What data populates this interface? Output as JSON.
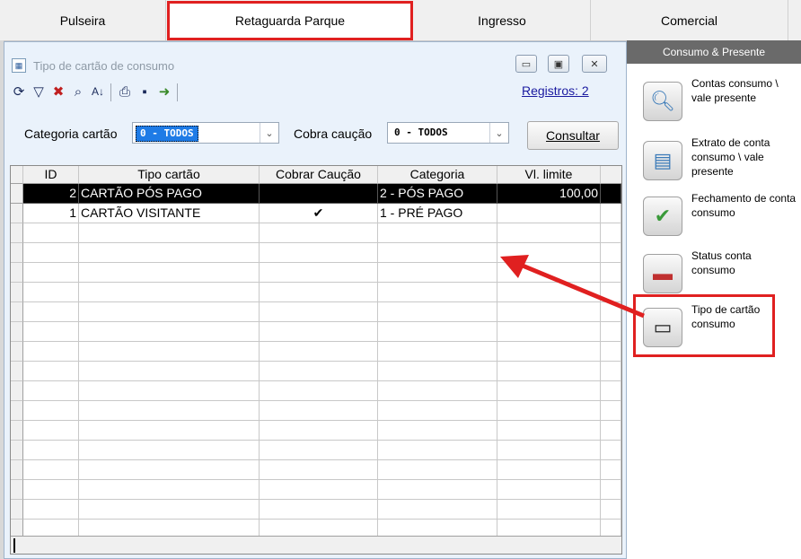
{
  "tabs": [
    {
      "label": "Pulseira",
      "active": false
    },
    {
      "label": "Retaguarda Parque",
      "active": true
    },
    {
      "label": "Ingresso",
      "active": false
    },
    {
      "label": "Comercial",
      "active": false
    }
  ],
  "window": {
    "title": "Tipo de cartão de consumo",
    "registros": "Registros: 2"
  },
  "filters": {
    "categoria_label": "Categoria cartão",
    "categoria_value": "0 - TODOS",
    "caucao_label": "Cobra caução",
    "caucao_value": "0 - TODOS",
    "consultar_label": "Consultar"
  },
  "grid": {
    "columns": [
      "ID",
      "Tipo cartão",
      "Cobrar Caução",
      "Categoria",
      "Vl. limite"
    ],
    "rows": [
      {
        "id": "2",
        "tipo": "CARTÃO PÓS PAGO",
        "caucao": "",
        "categoria": "2 - PÓS PAGO",
        "limite": "100,00",
        "selected": true
      },
      {
        "id": "1",
        "tipo": "CARTÃO VISITANTE",
        "caucao": "✔",
        "categoria": "1 - PRÉ PAGO",
        "limite": "",
        "selected": false
      }
    ]
  },
  "panel": {
    "header": "Consumo & Presente",
    "items": [
      {
        "label": "Contas consumo \\ vale presente",
        "icon": "magnifier-document-icon"
      },
      {
        "label": "Extrato de conta consumo \\ vale presente",
        "icon": "statement-document-icon"
      },
      {
        "label": "Fechamento de conta consumo",
        "icon": "card-check-icon"
      },
      {
        "label": "Status conta consumo",
        "icon": "card-status-icon"
      },
      {
        "label": "Tipo de cartão consumo",
        "icon": "card-wallet-icon"
      }
    ]
  },
  "colors": {
    "highlight": "#e02020",
    "selection": "#1e7be6",
    "panel_header": "#6a6a6a"
  }
}
